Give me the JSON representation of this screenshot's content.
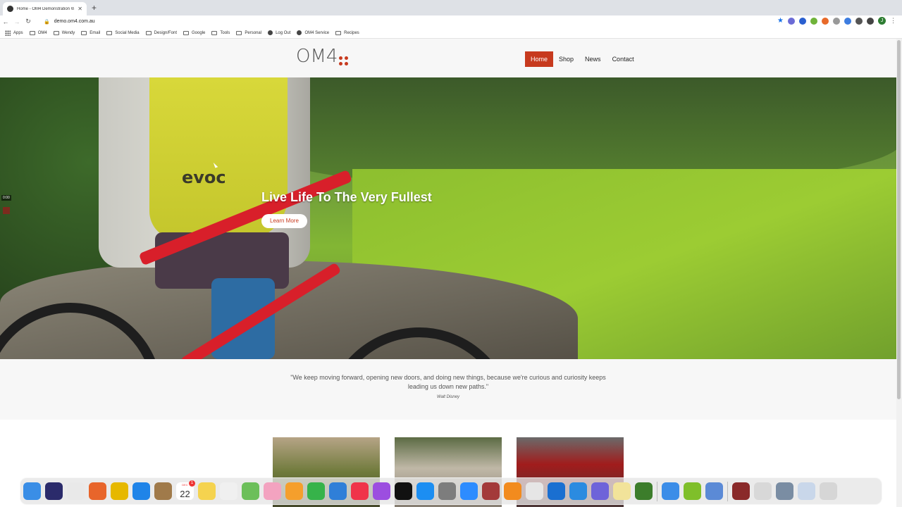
{
  "browser": {
    "tab_title": "Home - OM4 Demonstration W",
    "new_tab": "+",
    "url": "demo.om4.com.au",
    "bookmarks": [
      {
        "label": "Apps",
        "icon": "apps-grid-icon"
      },
      {
        "label": "OM4",
        "icon": "folder-icon"
      },
      {
        "label": "Wendy",
        "icon": "folder-icon"
      },
      {
        "label": "Email",
        "icon": "folder-icon"
      },
      {
        "label": "Social Media",
        "icon": "folder-icon"
      },
      {
        "label": "Design/Font",
        "icon": "folder-icon"
      },
      {
        "label": "Google",
        "icon": "folder-icon"
      },
      {
        "label": "Tools",
        "icon": "folder-icon"
      },
      {
        "label": "Personal",
        "icon": "folder-icon"
      },
      {
        "label": "Log Out",
        "icon": "globe-icon"
      },
      {
        "label": "OM4 Service",
        "icon": "globe-icon"
      },
      {
        "label": "Recipes",
        "icon": "folder-icon"
      }
    ],
    "avatar_letter": "J"
  },
  "site": {
    "logo": "OM4",
    "nav": [
      {
        "label": "Home",
        "active": true
      },
      {
        "label": "Shop",
        "active": false
      },
      {
        "label": "News",
        "active": false
      },
      {
        "label": "Contact",
        "active": false
      }
    ],
    "hero": {
      "title": "Live Life To The Very Fullest",
      "button": "Learn More",
      "backpack_brand": "evoc",
      "video_time": "0:00"
    },
    "quote": {
      "text": "\"We keep moving forward, opening new doors, and doing new things, because we're curious and curiosity keeps leading us down new paths.\"",
      "author": "Walt Disney"
    }
  },
  "dock": {
    "calendar_month": "DEC",
    "calendar_day": "22",
    "calendar_badge": "1",
    "apps": [
      {
        "name": "finder",
        "color": "#3a8ee6"
      },
      {
        "name": "siri",
        "color": "#2b2b6b"
      },
      {
        "name": "launchpad",
        "color": "#e9e9e9"
      },
      {
        "name": "firefox",
        "color": "#e8652b"
      },
      {
        "name": "chrome",
        "color": "#e6b800"
      },
      {
        "name": "safari",
        "color": "#1f84e8"
      },
      {
        "name": "notefile",
        "color": "#a07a4a"
      },
      {
        "name": "calendar",
        "color": "#ffffff"
      },
      {
        "name": "notes",
        "color": "#f5d34f"
      },
      {
        "name": "reminders",
        "color": "#f0f0f0"
      },
      {
        "name": "maps",
        "color": "#6cbf5a"
      },
      {
        "name": "photos",
        "color": "#f3a3c0"
      },
      {
        "name": "pages",
        "color": "#f59f2c"
      },
      {
        "name": "numbers",
        "color": "#36b34a"
      },
      {
        "name": "keynote",
        "color": "#2f7fd8"
      },
      {
        "name": "music",
        "color": "#f0344a"
      },
      {
        "name": "podcasts",
        "color": "#9c4ee0"
      },
      {
        "name": "apple-tv",
        "color": "#111111"
      },
      {
        "name": "app-store",
        "color": "#1c8ef2"
      },
      {
        "name": "system-preferences",
        "color": "#7d7d7d"
      },
      {
        "name": "zoom",
        "color": "#2d8cff"
      },
      {
        "name": "dictionary",
        "color": "#a33a3a"
      },
      {
        "name": "books",
        "color": "#f28b1e"
      },
      {
        "name": "textedit",
        "color": "#e6e6e6"
      },
      {
        "name": "1password",
        "color": "#1a6fd1"
      },
      {
        "name": "vpn",
        "color": "#2b8be0"
      },
      {
        "name": "settings-flower",
        "color": "#6e63d9"
      },
      {
        "name": "stickies",
        "color": "#f2e39a"
      },
      {
        "name": "frogger",
        "color": "#3c7d2b"
      },
      {
        "name": "mail",
        "color": "#3b8de8"
      },
      {
        "name": "w-app",
        "color": "#7fbf2a"
      },
      {
        "name": "preview",
        "color": "#5b8ad6"
      },
      {
        "name": "recent-doc",
        "color": "#8a2a2a"
      },
      {
        "name": "chrome-doc",
        "color": "#d8d8d8"
      },
      {
        "name": "screenshot-doc",
        "color": "#7a8da3"
      },
      {
        "name": "downloads",
        "color": "#c9d7ea"
      },
      {
        "name": "trash",
        "color": "#d6d6d6"
      }
    ]
  }
}
